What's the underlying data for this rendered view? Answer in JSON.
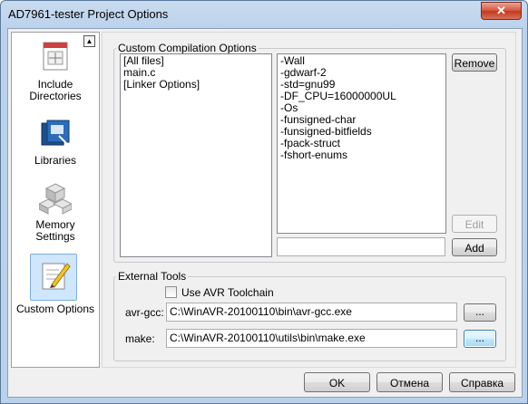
{
  "window": {
    "title": "AD7961-tester Project Options",
    "close_glyph": "✕"
  },
  "sidebar": {
    "scroll_glyph": "▲",
    "items": [
      {
        "label_line1": "Include",
        "label_line2": "Directories",
        "icon": "include-directories-icon"
      },
      {
        "label_line1": "Libraries",
        "label_line2": "",
        "icon": "libraries-icon"
      },
      {
        "label_line1": "Memory",
        "label_line2": "Settings",
        "icon": "memory-settings-icon"
      },
      {
        "label_line1": "Custom Options",
        "label_line2": "",
        "icon": "custom-options-icon",
        "selected": true
      }
    ]
  },
  "custom_compilation": {
    "legend": "Custom Compilation Options",
    "files": [
      "[All files]",
      "main.c",
      "[Linker Options]"
    ],
    "options": [
      "-Wall",
      "-gdwarf-2",
      "-std=gnu99",
      "-DF_CPU=16000000UL",
      "-Os",
      "-funsigned-char",
      "-funsigned-bitfields",
      "-fpack-struct",
      "-fshort-enums"
    ],
    "remove_label": "Remove",
    "edit_label": "Edit",
    "add_label": "Add",
    "new_option_value": ""
  },
  "external_tools": {
    "legend": "External Tools",
    "use_toolchain_label": "Use AVR Toolchain",
    "use_toolchain_checked": false,
    "avr_gcc_label": "avr-gcc:",
    "avr_gcc_path": "C:\\WinAVR-20100110\\bin\\avr-gcc.exe",
    "make_label": "make:",
    "make_path": "C:\\WinAVR-20100110\\utils\\bin\\make.exe",
    "browse_label": "..."
  },
  "buttons": {
    "ok": "OK",
    "cancel": "Отмена",
    "help": "Справка"
  },
  "colors": {
    "accent_selection": "#cfe6fc",
    "close_red": "#c33a1f"
  }
}
